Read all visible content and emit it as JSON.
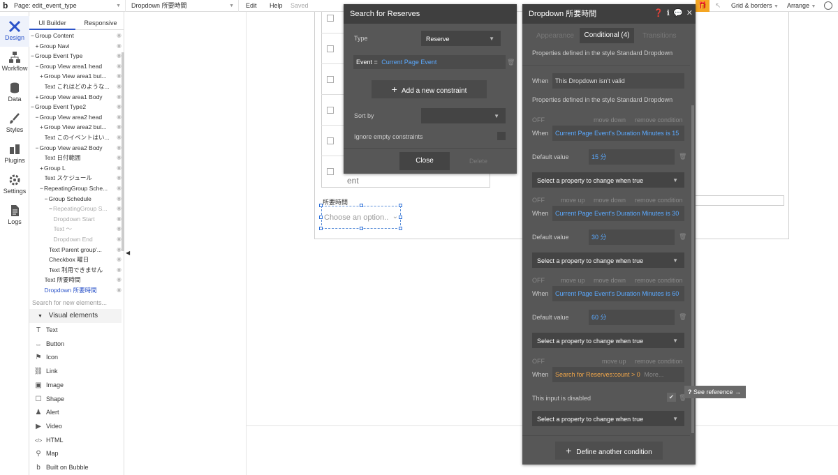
{
  "topbar": {
    "page_label": "Page: edit_event_type",
    "element_label": "Dropdown 所要時間",
    "menu_edit": "Edit",
    "menu_help": "Help",
    "saved": "Saved",
    "grid_borders": "Grid & borders",
    "arrange": "Arrange"
  },
  "left_icons": [
    "Design",
    "Workflow",
    "Data",
    "Styles",
    "Plugins",
    "Settings",
    "Logs"
  ],
  "tree": {
    "tab_ui": "UI Builder",
    "tab_responsive": "Responsive",
    "items": [
      {
        "label": "Group Content",
        "indent": 0,
        "prefix": "−"
      },
      {
        "label": "Group Navi",
        "indent": 1,
        "prefix": "+"
      },
      {
        "label": "Group Event Type",
        "indent": 0,
        "prefix": "−"
      },
      {
        "label": "Group View area1 head",
        "indent": 1,
        "prefix": "−"
      },
      {
        "label": "Group View area1 but...",
        "indent": 2,
        "prefix": "+"
      },
      {
        "label": "Text これはどのような...",
        "indent": 3,
        "prefix": ""
      },
      {
        "label": "Group View area1 Body",
        "indent": 1,
        "prefix": "+"
      },
      {
        "label": "Group Event Type2",
        "indent": 0,
        "prefix": "−"
      },
      {
        "label": "Group View area2 head",
        "indent": 1,
        "prefix": "−"
      },
      {
        "label": "Group View area2 but...",
        "indent": 2,
        "prefix": "+"
      },
      {
        "label": "Text このイベントはい...",
        "indent": 3,
        "prefix": ""
      },
      {
        "label": "Group View area2 Body",
        "indent": 1,
        "prefix": "−"
      },
      {
        "label": "Text 日付範囲",
        "indent": 3,
        "prefix": ""
      },
      {
        "label": "Group L",
        "indent": 2,
        "prefix": "+"
      },
      {
        "label": "Text スケジュール",
        "indent": 3,
        "prefix": ""
      },
      {
        "label": "RepeatingGroup Sche...",
        "indent": 2,
        "prefix": "−"
      },
      {
        "label": "Group Schedule",
        "indent": 3,
        "prefix": "−"
      },
      {
        "label": "RepeatingGroup S...",
        "indent": 4,
        "prefix": "−"
      },
      {
        "label": "Dropdown Start",
        "indent": 5,
        "prefix": ""
      },
      {
        "label": "Text 〜",
        "indent": 5,
        "prefix": ""
      },
      {
        "label": "Dropdown End",
        "indent": 5,
        "prefix": ""
      },
      {
        "label": "Text Parent group'...",
        "indent": 4,
        "prefix": ""
      },
      {
        "label": "Checkbox 曜日",
        "indent": 4,
        "prefix": ""
      },
      {
        "label": "Text 利用できません",
        "indent": 4,
        "prefix": ""
      },
      {
        "label": "Text 所要時間",
        "indent": 3,
        "prefix": ""
      },
      {
        "label": "Dropdown 所要時間",
        "indent": 3,
        "prefix": ""
      }
    ],
    "search_placeholder": "Search for new elements...",
    "visual_elements": "Visual elements",
    "palette": [
      "Text",
      "Button",
      "Icon",
      "Link",
      "Image",
      "Shape",
      "Alert",
      "Video",
      "HTML",
      "Map",
      "Built on Bubble"
    ]
  },
  "canvas": {
    "label_duration": "所要時間",
    "dropdown_placeholder": "Choose an option..",
    "partial_text": "ent"
  },
  "search_panel": {
    "title": "Search for Reserves",
    "type_label": "Type",
    "type_value": "Reserve",
    "constraint_key": "Event =",
    "constraint_value": "Current Page Event",
    "add_constraint": "Add a new constraint",
    "sort_label": "Sort by",
    "ignore_label": "Ignore empty constraints",
    "close": "Close",
    "delete": "Delete"
  },
  "prop_panel": {
    "title": "Dropdown 所要時間",
    "tab_appearance": "Appearance",
    "tab_conditional": "Conditional (4)",
    "tab_transitions": "Transitions",
    "style_note_1": "Properties defined in the style Standard Dropdown",
    "when_label": "When",
    "when_invalid": "This Dropdown isn't valid",
    "style_note_2": "Properties defined in the style Standard Dropdown",
    "off": "OFF",
    "move_up": "move up",
    "move_down": "move down",
    "remove": "remove condition",
    "default_value_label": "Default value",
    "select_property": "Select a property to change when true",
    "cond1": "Current Page Event's Duration Minutes is 15",
    "val1": "15 分",
    "cond2": "Current Page Event's Duration Minutes is 30",
    "val2": "30 分",
    "cond3": "Current Page Event's Duration Minutes is 60",
    "val3": "60 分",
    "cond4": "Search for Reserves:count > 0",
    "more": "More...",
    "disabled_label": "This input is disabled",
    "see_reference": "See reference →",
    "define_another": "Define another condition"
  },
  "colors": {
    "accent": "#2b53c9",
    "panel_bg": "#575757",
    "panel_header": "#3f3f3f",
    "link_blue": "#5aa9ff",
    "orange": "#f0a64a",
    "gift": "#f5a623"
  }
}
